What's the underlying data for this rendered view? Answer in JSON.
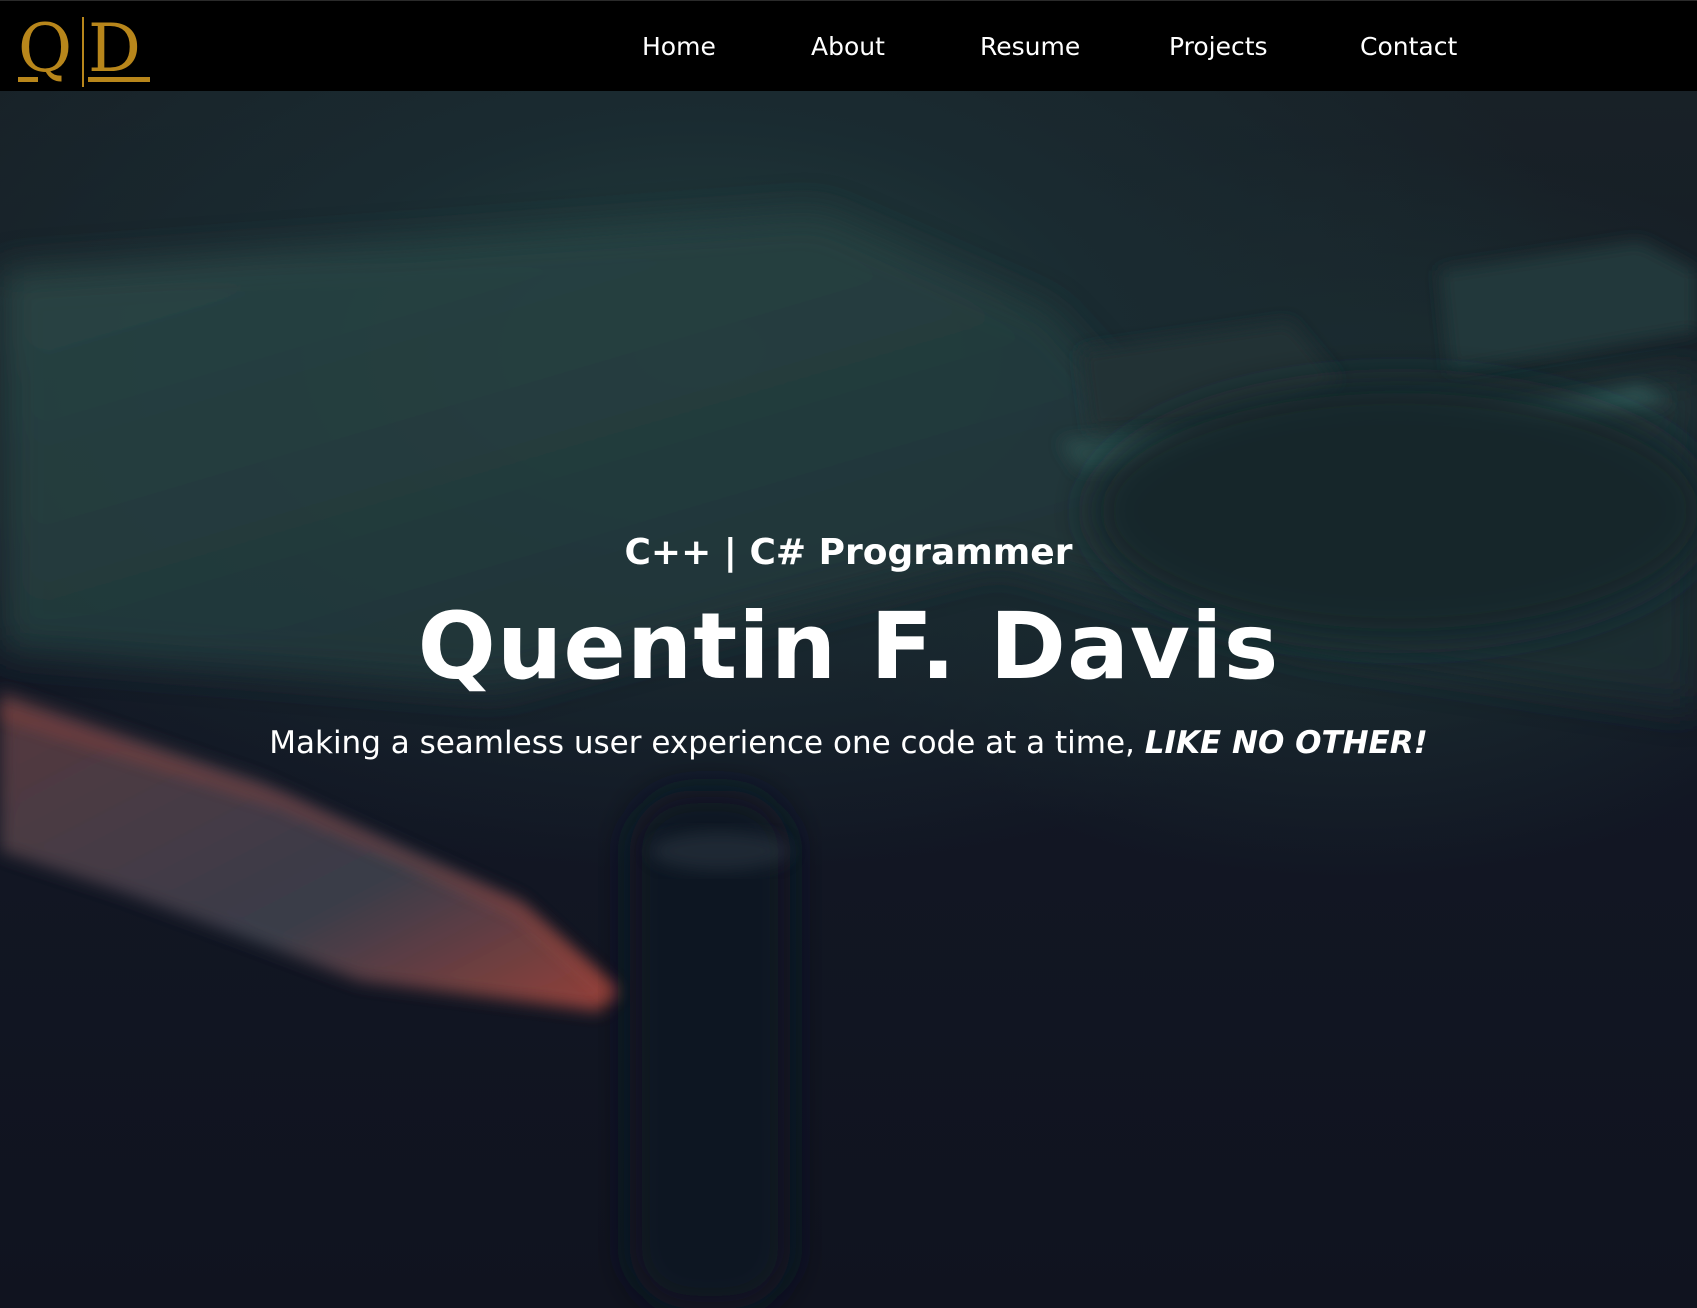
{
  "brand": {
    "logo_text_left": "Q",
    "logo_text_right": "D",
    "logo_color": "#b8861b"
  },
  "nav": {
    "items": [
      {
        "label": "Home"
      },
      {
        "label": "About"
      },
      {
        "label": "Resume"
      },
      {
        "label": "Projects"
      },
      {
        "label": "Contact"
      }
    ]
  },
  "hero": {
    "role": "C++ | C# Programmer",
    "name": "Quentin F. Davis",
    "tagline_main": "Making a seamless user experience one code at a time, ",
    "tagline_emphasis": "LIKE NO OTHER!",
    "background_description_colors": {
      "dark": "#10131f",
      "teal": "#23403f",
      "accent_red": "#b0463a"
    }
  },
  "colors": {
    "navbar_bg": "#000000",
    "text": "#ffffff",
    "accent": "#b8861b"
  }
}
